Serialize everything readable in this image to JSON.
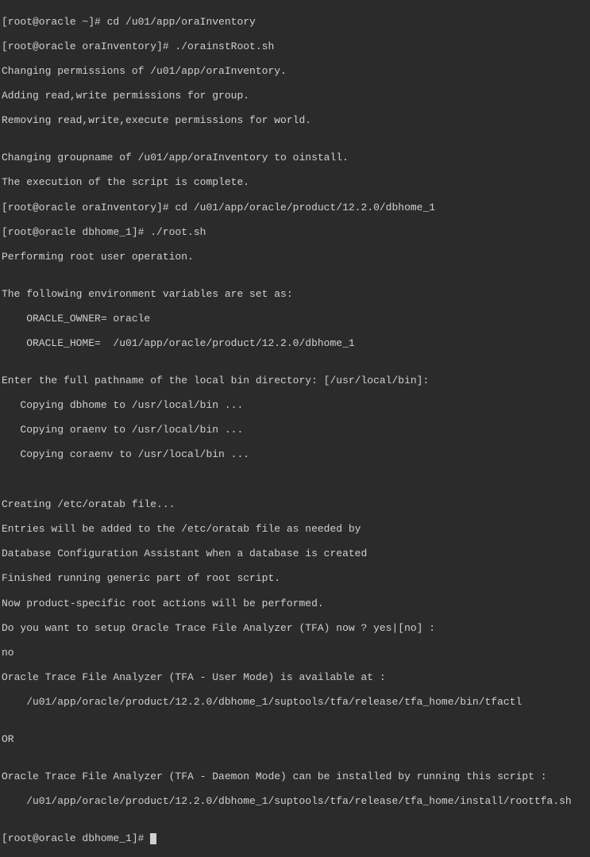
{
  "terminal": {
    "lines": [
      "[root@oracle ~]# cd /u01/app/oraInventory",
      "[root@oracle oraInventory]# ./orainstRoot.sh",
      "Changing permissions of /u01/app/oraInventory.",
      "Adding read,write permissions for group.",
      "Removing read,write,execute permissions for world.",
      "",
      "Changing groupname of /u01/app/oraInventory to oinstall.",
      "The execution of the script is complete.",
      "[root@oracle oraInventory]# cd /u01/app/oracle/product/12.2.0/dbhome_1",
      "[root@oracle dbhome_1]# ./root.sh",
      "Performing root user operation.",
      "",
      "The following environment variables are set as:",
      "    ORACLE_OWNER= oracle",
      "    ORACLE_HOME=  /u01/app/oracle/product/12.2.0/dbhome_1",
      "",
      "Enter the full pathname of the local bin directory: [/usr/local/bin]:",
      "   Copying dbhome to /usr/local/bin ...",
      "   Copying oraenv to /usr/local/bin ...",
      "   Copying coraenv to /usr/local/bin ...",
      "",
      "",
      "Creating /etc/oratab file...",
      "Entries will be added to the /etc/oratab file as needed by",
      "Database Configuration Assistant when a database is created",
      "Finished running generic part of root script.",
      "Now product-specific root actions will be performed.",
      "Do you want to setup Oracle Trace File Analyzer (TFA) now ? yes|[no] :",
      "no",
      "Oracle Trace File Analyzer (TFA - User Mode) is available at :",
      "    /u01/app/oracle/product/12.2.0/dbhome_1/suptools/tfa/release/tfa_home/bin/tfactl",
      "",
      "OR",
      "",
      "Oracle Trace File Analyzer (TFA - Daemon Mode) can be installed by running this script :",
      "    /u01/app/oracle/product/12.2.0/dbhome_1/suptools/tfa/release/tfa_home/install/roottfa.sh",
      "",
      "[root@oracle dbhome_1]# "
    ]
  }
}
